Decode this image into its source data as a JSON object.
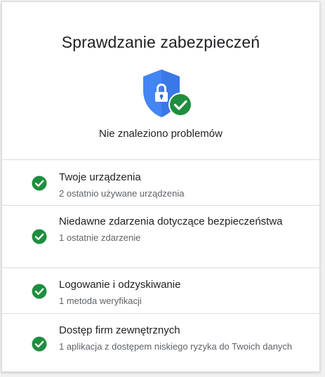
{
  "header": {
    "title": "Sprawdzanie zabezpieczeń",
    "shield_icon": "shield-lock-icon",
    "badge_icon": "check-badge-icon",
    "summary": "Nie znaleziono problemów"
  },
  "items": [
    {
      "name": "Twoje urządzenia",
      "desc": "2 ostatnio używane urządzenia",
      "icon": "check-circle-icon"
    },
    {
      "name": "Niedawne zdarzenia dotyczące bezpieczeństwa",
      "desc": "1 ostatnie zdarzenie",
      "icon": "check-circle-icon"
    },
    {
      "name": "Logowanie i odzyskiwanie",
      "desc": "1 metoda weryfikacji",
      "icon": "check-circle-icon"
    },
    {
      "name": "Dostęp firm zewnętrznych",
      "desc": "1 aplikacja z dostępem niskiego ryzyka do Twoich danych",
      "icon": "check-circle-icon"
    }
  ],
  "colors": {
    "shield": "#4285f4",
    "shield_dark": "#3367d6",
    "success": "#1e8e3e",
    "text": "#202124",
    "secondary_text": "#5f6368",
    "divider": "#dadce0"
  }
}
